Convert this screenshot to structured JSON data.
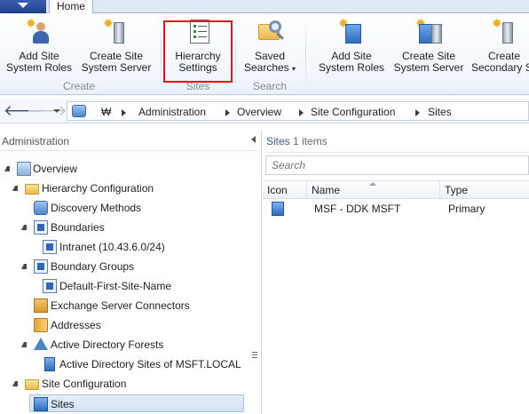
{
  "ribbon": {
    "active_tab": "Home",
    "groups": {
      "create": {
        "label": "Create",
        "add_site_system_roles": [
          "Add Site",
          "System Roles"
        ],
        "create_site_system_server": [
          "Create Site",
          "System Server"
        ]
      },
      "sites": {
        "label": "Sites",
        "hierarchy_settings": [
          "Hierarchy",
          "Settings"
        ]
      },
      "search": {
        "label": "Search",
        "saved_searches": [
          "Saved",
          "Searches"
        ]
      },
      "site": {
        "add_site_system_roles": [
          "Add Site",
          "System Roles"
        ],
        "create_site_system_server": [
          "Create Site",
          "System Server"
        ],
        "create_secondary_site": [
          "Create",
          "Secondary S"
        ]
      }
    }
  },
  "address": {
    "root": "₩",
    "crumbs": [
      "Administration",
      "Overview",
      "Site Configuration",
      "Sites"
    ]
  },
  "nav": {
    "title": "Administration",
    "tree": [
      {
        "label": "Overview",
        "icon": "overview-icon",
        "expanded": true
      },
      {
        "label": "Hierarchy Configuration",
        "icon": "folder-icon",
        "expanded": true
      },
      {
        "label": "Discovery Methods",
        "icon": "discovery-icon"
      },
      {
        "label": "Boundaries",
        "icon": "boundary-icon",
        "expanded": true
      },
      {
        "label": "Intranet (10.43.6.0/24)",
        "icon": "boundary-icon"
      },
      {
        "label": "Boundary Groups",
        "icon": "boundary-group-icon",
        "expanded": true
      },
      {
        "label": "Default-First-Site-Name",
        "icon": "boundary-icon"
      },
      {
        "label": "Exchange Server Connectors",
        "icon": "exchange-icon"
      },
      {
        "label": "Addresses",
        "icon": "address-book-icon"
      },
      {
        "label": "Active Directory Forests",
        "icon": "forest-icon",
        "expanded": true
      },
      {
        "label": "Active Directory Sites of MSFT.LOCAL",
        "icon": "ad-site-icon"
      },
      {
        "label": "Site Configuration",
        "icon": "folder-icon",
        "expanded": true
      },
      {
        "label": "Sites",
        "icon": "site-icon",
        "selected": true
      }
    ]
  },
  "content": {
    "title": "Sites",
    "count": "1 items",
    "search_placeholder": "Search",
    "columns": [
      "Icon",
      "Name",
      "Type"
    ],
    "rows": [
      {
        "name": "MSF - DDK MSFT",
        "type": "Primary"
      }
    ]
  },
  "colors": {
    "highlight_box": "#e2131b",
    "selection": "#d3e1f4",
    "ribbon_bg": "#f3f7fc"
  }
}
